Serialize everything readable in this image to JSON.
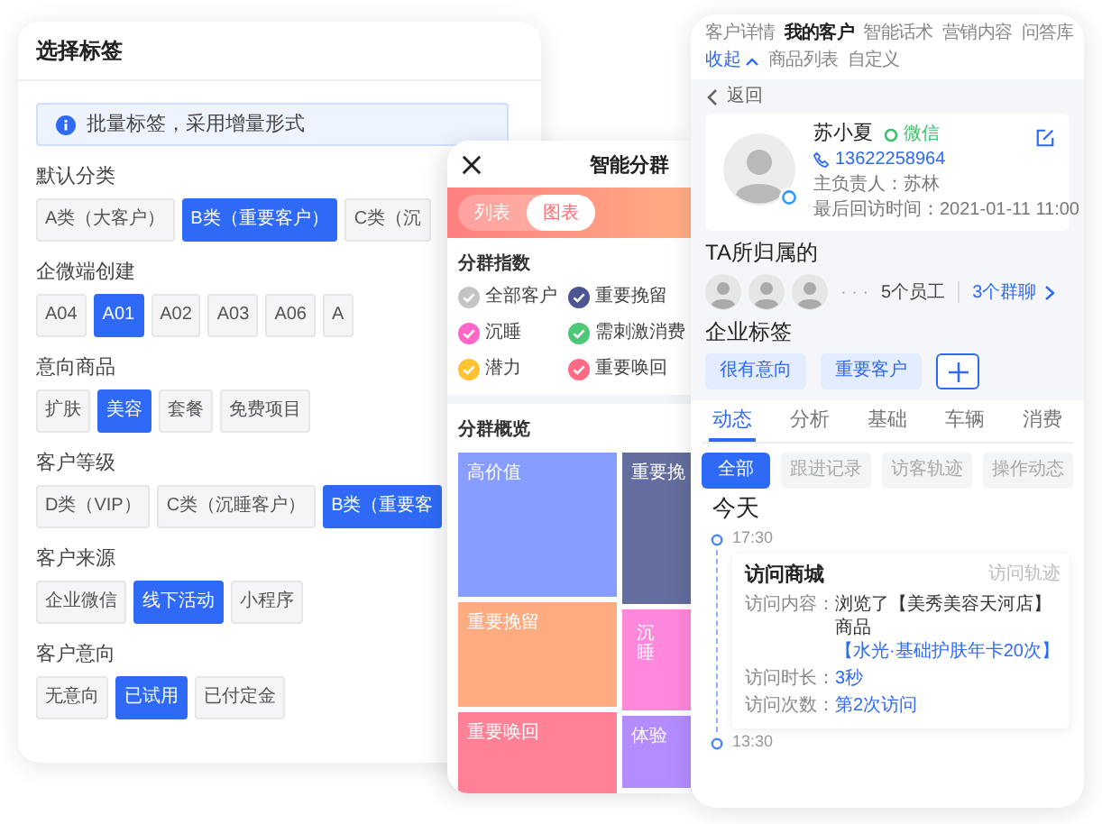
{
  "left_panel": {
    "title": "选择标签",
    "notice": "批量标签，采用增量形式",
    "groups": [
      {
        "label": "默认分类",
        "options": [
          {
            "label": "A类（大客户）",
            "selected": false
          },
          {
            "label": "B类（重要客户）",
            "selected": true
          },
          {
            "label": "C类（沉",
            "selected": false
          }
        ]
      },
      {
        "label": "企微端创建",
        "options": [
          {
            "label": "A04",
            "selected": false
          },
          {
            "label": "A01",
            "selected": true
          },
          {
            "label": "A02",
            "selected": false
          },
          {
            "label": "A03",
            "selected": false
          },
          {
            "label": "A06",
            "selected": false
          },
          {
            "label": "A",
            "selected": false
          }
        ]
      },
      {
        "label": "意向商品",
        "options": [
          {
            "label": "扩肤",
            "selected": false
          },
          {
            "label": "美容",
            "selected": true
          },
          {
            "label": "套餐",
            "selected": false
          },
          {
            "label": "免费项目",
            "selected": false
          }
        ]
      },
      {
        "label": "客户等级",
        "options": [
          {
            "label": "D类（VIP）",
            "selected": false
          },
          {
            "label": "C类（沉睡客户）",
            "selected": false
          },
          {
            "label": "B类（重要客",
            "selected": true
          }
        ]
      },
      {
        "label": "客户来源",
        "options": [
          {
            "label": "企业微信",
            "selected": false
          },
          {
            "label": "线下活动",
            "selected": true
          },
          {
            "label": "小程序",
            "selected": false
          }
        ]
      },
      {
        "label": "客户意向",
        "options": [
          {
            "label": "无意向",
            "selected": false
          },
          {
            "label": "已试用",
            "selected": true
          },
          {
            "label": "已付定金",
            "selected": false
          }
        ]
      }
    ]
  },
  "segment_panel": {
    "title": "智能分群",
    "view_tabs": [
      {
        "label": "列表",
        "selected": false
      },
      {
        "label": "图表",
        "selected": true
      }
    ],
    "index_title": "分群指数",
    "legend": [
      {
        "label": "全部客户",
        "color": "#c4c4c4"
      },
      {
        "label": "重要挽留",
        "color": "#4b5592"
      },
      {
        "label": "沉睡",
        "color": "#ff66c8"
      },
      {
        "label": "需刺激消费",
        "color": "#4cc878"
      },
      {
        "label": "潜力",
        "color": "#ffc233"
      },
      {
        "label": "重要唤回",
        "color": "#ff6b85"
      }
    ],
    "overview_title": "分群概览",
    "treemap": [
      {
        "blocks": [
          {
            "label": "高价值",
            "color": "#879dff"
          },
          {
            "label": "重要挽留",
            "color": "#ffab80"
          },
          {
            "label": "重要唤回",
            "color": "#ff8196"
          }
        ]
      },
      {
        "blocks": [
          {
            "label": "重要挽",
            "color": "#636e9e"
          },
          {
            "label": "沉睡",
            "color": "#ff88dc",
            "kind": "vertical"
          },
          {
            "label": "体验",
            "color": "#b38cff"
          }
        ]
      }
    ]
  },
  "customer_panel": {
    "tabs": [
      {
        "label": "客户详情",
        "selected": false
      },
      {
        "label": "我的客户",
        "selected": true
      },
      {
        "label": "智能话术",
        "selected": false
      },
      {
        "label": "营销内容",
        "selected": false
      },
      {
        "label": "问答库",
        "selected": false
      }
    ],
    "collapse": "收起",
    "more_tabs": [
      {
        "label": "商品列表",
        "selected": false
      },
      {
        "label": "自定义",
        "selected": false
      }
    ],
    "back": "返回",
    "profile": {
      "name": "苏小夏",
      "channel": "微信",
      "phone": "13622258964",
      "owner": "主负责人：苏林",
      "last_visit": "最后回访时间：2021-01-11 11:00"
    },
    "belongs": {
      "title": "TA所归属的",
      "more": "· · ·",
      "staff": "5个员工",
      "groups": "3个群聊"
    },
    "tags": {
      "title": "企业标签",
      "items": [
        "很有意向",
        "重要客户"
      ]
    },
    "detail_tabs": [
      {
        "label": "动态",
        "selected": true
      },
      {
        "label": "分析",
        "selected": false
      },
      {
        "label": "基础",
        "selected": false
      },
      {
        "label": "车辆",
        "selected": false
      },
      {
        "label": "消费",
        "selected": false
      }
    ],
    "filters": [
      {
        "label": "全部",
        "selected": true
      },
      {
        "label": "跟进记录",
        "selected": false
      },
      {
        "label": "访客轨迹",
        "selected": false
      },
      {
        "label": "操作动态",
        "selected": false
      }
    ],
    "day": "今天",
    "timeline": [
      {
        "time": "17:30",
        "card": {
          "title": "访问商城",
          "source": "访问轨迹",
          "rows": [
            {
              "label": "访问内容：",
              "text": "浏览了【美秀美容天河店】商品",
              "link": "【水光·基础护肤年卡20次】"
            },
            {
              "label": "访问时长：",
              "value": "3秒"
            },
            {
              "label": "访问次数：",
              "value": "第2次访问"
            }
          ]
        }
      },
      {
        "time": "13:30"
      }
    ]
  }
}
